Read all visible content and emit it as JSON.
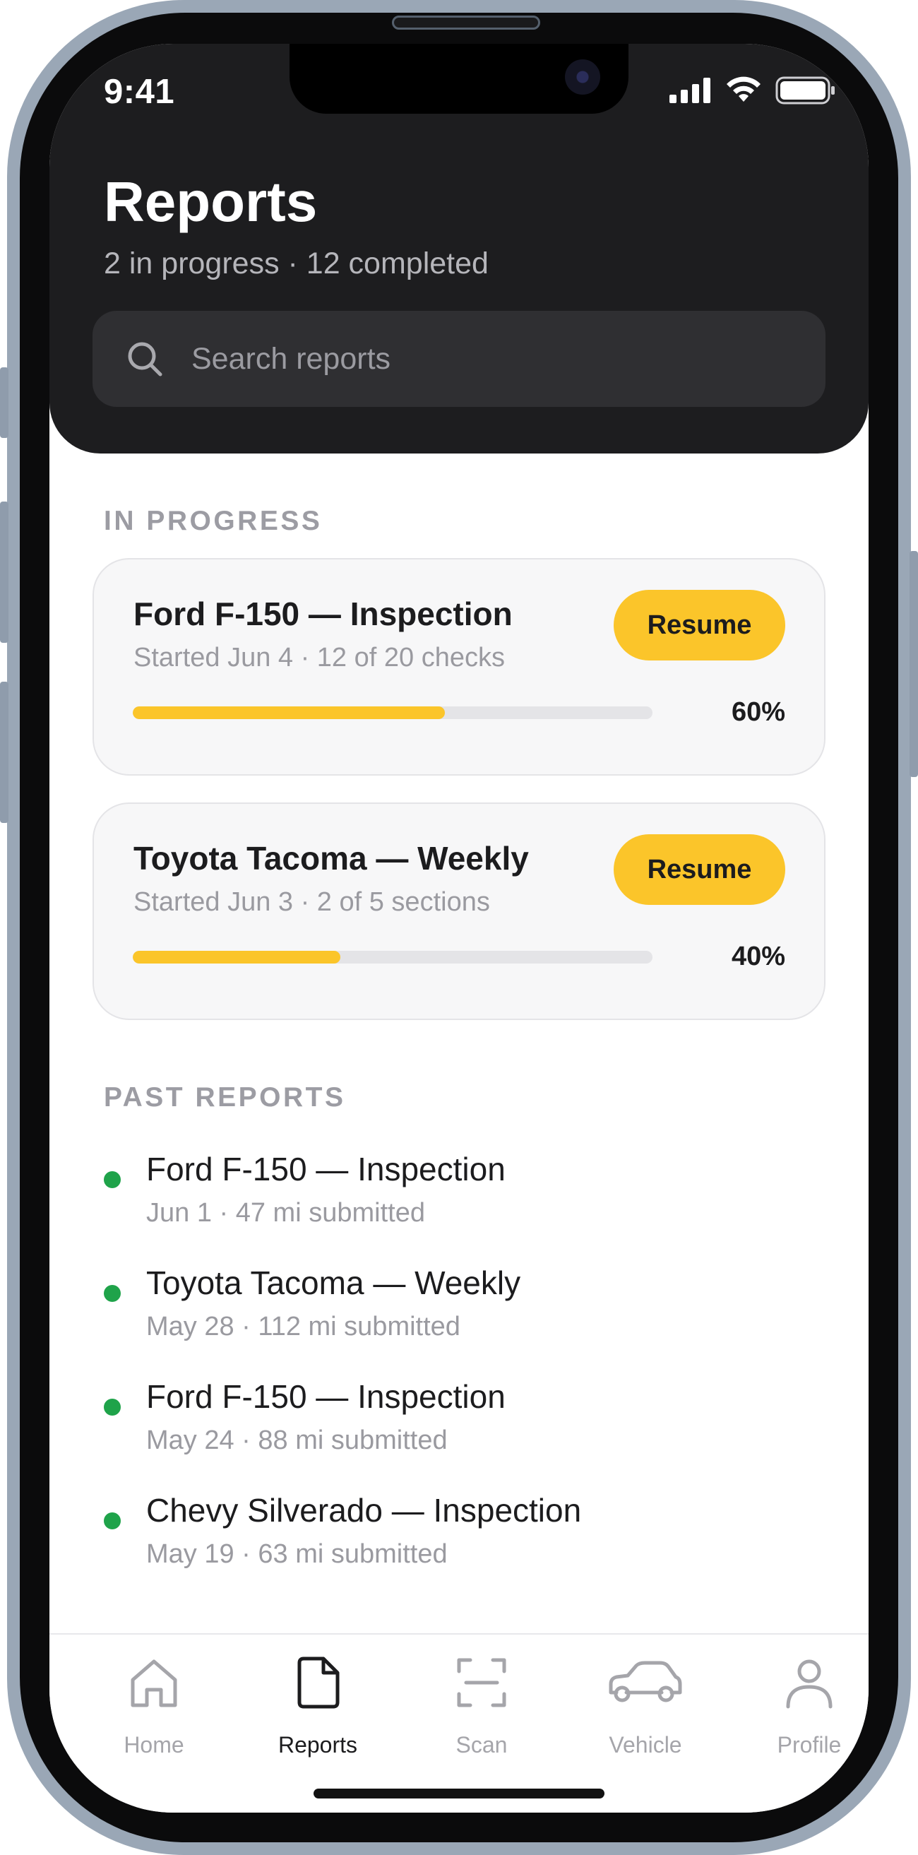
{
  "status_bar": {
    "time": "9:41"
  },
  "header": {
    "title": "Reports",
    "subtitle": "2 in progress · 12 completed",
    "search_placeholder": "Search reports"
  },
  "in_progress": {
    "label": "IN PROGRESS",
    "items": [
      {
        "title": "Ford F-150 — Inspection",
        "meta": "Started Jun 4 · 12 of 20 checks",
        "button": "Resume",
        "percent_label": "60%",
        "progress": 0.6
      },
      {
        "title": "Toyota Tacoma — Weekly",
        "meta": "Started Jun 3 · 2 of 5 sections",
        "button": "Resume",
        "percent_label": "40%",
        "progress": 0.4
      }
    ]
  },
  "past": {
    "label": "PAST REPORTS",
    "items": [
      {
        "title": "Ford F-150 — Inspection",
        "meta": "Jun 1 · 47 mi submitted"
      },
      {
        "title": "Toyota Tacoma — Weekly",
        "meta": "May 28 · 112 mi submitted"
      },
      {
        "title": "Ford F-150 — Inspection",
        "meta": "May 24 · 88 mi submitted"
      },
      {
        "title": "Chevy Silverado — Inspection",
        "meta": "May 19 · 63 mi submitted"
      }
    ]
  },
  "tabbar": {
    "tabs": [
      {
        "label": "Home",
        "icon": "home-icon"
      },
      {
        "label": "Reports",
        "icon": "document-icon",
        "active": true
      },
      {
        "label": "Scan",
        "icon": "scan-icon"
      },
      {
        "label": "Vehicle",
        "icon": "car-icon"
      },
      {
        "label": "Profile",
        "icon": "person-icon"
      }
    ]
  },
  "colors": {
    "accent": "#fbc52a",
    "header_bg": "#1d1d1f",
    "status_done": "#1fa34a"
  }
}
